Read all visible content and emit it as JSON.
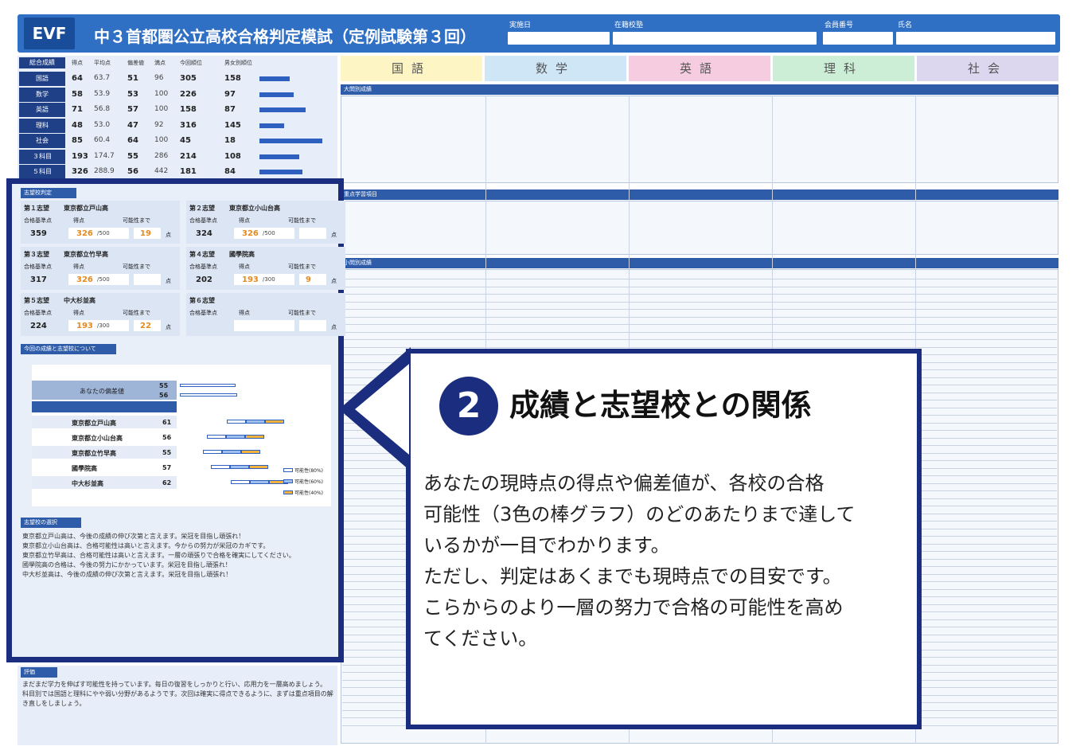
{
  "header": {
    "logo": "EVF",
    "title": "中３首都圏公立高校合格判定模試（定例試験第３回）",
    "fields": [
      "実施日",
      "在籍校塾",
      "会員番号",
      "氏名"
    ]
  },
  "subjects": [
    {
      "label": "国語",
      "color": "#fdf5c3"
    },
    {
      "label": "数学",
      "color": "#cfe6f7"
    },
    {
      "label": "英語",
      "color": "#f6cde0"
    },
    {
      "label": "理科",
      "color": "#cdeed6"
    },
    {
      "label": "社会",
      "color": "#dcd6ef"
    }
  ],
  "summary": {
    "header": [
      "総合成績",
      "得点",
      "平均点",
      "偏差値",
      "満点",
      "今回順位",
      "男女別順位"
    ],
    "rows": [
      {
        "label": "国語",
        "v": [
          "64",
          "63.7",
          "51",
          "96",
          "305",
          "158"
        ],
        "bar": 0.42
      },
      {
        "label": "数学",
        "v": [
          "58",
          "53.9",
          "53",
          "100",
          "226",
          "97"
        ],
        "bar": 0.48
      },
      {
        "label": "英語",
        "v": [
          "71",
          "56.8",
          "57",
          "100",
          "158",
          "87"
        ],
        "bar": 0.64
      },
      {
        "label": "理科",
        "v": [
          "48",
          "53.0",
          "47",
          "92",
          "316",
          "145"
        ],
        "bar": 0.34
      },
      {
        "label": "社会",
        "v": [
          "85",
          "60.4",
          "64",
          "100",
          "45",
          "18"
        ],
        "bar": 0.88
      },
      {
        "label": "３科目",
        "v": [
          "193",
          "174.7",
          "55",
          "286",
          "214",
          "108"
        ],
        "bar": 0.56
      },
      {
        "label": "５科目",
        "v": [
          "326",
          "288.9",
          "56",
          "442",
          "181",
          "84"
        ],
        "bar": 0.6
      }
    ]
  },
  "shibou": {
    "section": "志望校判定",
    "choices": [
      {
        "rank": "第１志望",
        "name": "東京都立戸山高",
        "base": "359",
        "score": "326",
        "outof": "/500",
        "need": "19",
        "unit": "点"
      },
      {
        "rank": "第２志望",
        "name": "東京都立小山台高",
        "base": "324",
        "score": "326",
        "outof": "/500",
        "need": "",
        "unit": "点"
      },
      {
        "rank": "第３志望",
        "name": "東京都立竹早高",
        "base": "317",
        "score": "326",
        "outof": "/500",
        "need": "",
        "unit": "点"
      },
      {
        "rank": "第４志望",
        "name": "國學院高",
        "base": "202",
        "score": "193",
        "outof": "/300",
        "need": "9",
        "unit": "点"
      },
      {
        "rank": "第５志望",
        "name": "中大杉並高",
        "base": "224",
        "score": "193",
        "outof": "/300",
        "need": "22",
        "unit": "点"
      },
      {
        "rank": "第６志望",
        "name": "",
        "base": "",
        "score": "",
        "outof": "",
        "need": "",
        "unit": "点"
      }
    ],
    "col_labels": [
      "合格基準点",
      "得点",
      "可能性まで"
    ]
  },
  "relation": {
    "section": "今回の成績と志望校について",
    "you_label": "あなたの偏差値",
    "you_values": [
      "55",
      "56"
    ],
    "schools": [
      {
        "name": "東京都立戸山高",
        "value": "61"
      },
      {
        "name": "東京都立小山台高",
        "value": "56"
      },
      {
        "name": "東京都立竹早高",
        "value": "55"
      },
      {
        "name": "國學院高",
        "value": "57"
      },
      {
        "name": "中大杉並高",
        "value": "62"
      }
    ],
    "legend": [
      "可能性(80%)",
      "可能性(60%)",
      "可能性(40%)"
    ]
  },
  "advice": {
    "section": "志望校の選択",
    "text": "東京都立戸山高は、今後の成績の伸び次第と言えます。栄冠を目指し頑張れ！\n東京都立小山台高は、合格可能性は高いと言えます。今からの努力が栄冠のカギです。\n東京都立竹早高は、合格可能性は高いと言えます。一層の頑張りで合格を確実にしてください。\n國學院高の合格は、今後の努力にかかっています。栄冠を目指し頑張れ！\n中大杉並高は、今後の成績の伸び次第と言えます。栄冠を目指し頑張れ！"
  },
  "hyouka": {
    "section": "評価",
    "text": "まだまだ学力を伸ばす可能性を持っています。毎日の復習をしっかりと行い、応用力を一層高めましょう。\n科目別では国語と理科にやや弱い分野があるようです。次回は確実に得点できるように、まずは重点項目の解き直しをしましょう。"
  },
  "right_sections": [
    "大問別成績",
    "重点学習項目",
    "小問別成績"
  ],
  "callout": {
    "number": "2",
    "title": "成績と志望校との関係",
    "body": "あなたの現時点の得点や偏差値が、各校の合格\n可能性（3色の棒グラフ）のどのあたりまで達して\nいるかが一目でわかります。\nただし、判定はあくまでも現時点での目安です。\nこらからのより一層の努力で合格の可能性を高め\nてください。"
  }
}
